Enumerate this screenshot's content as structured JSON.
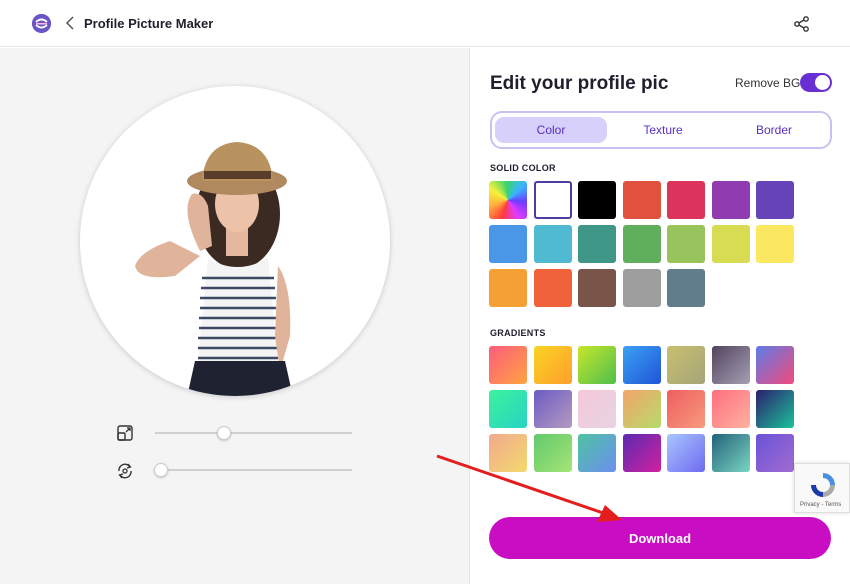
{
  "header": {
    "title": "Profile Picture Maker",
    "logo_icon": "app-logo-icon",
    "back_icon": "chevron-left-icon",
    "share_icon": "share-icon"
  },
  "editor": {
    "title": "Edit your profile pic",
    "remove_bg_label": "Remove BG",
    "remove_bg_enabled": true,
    "tabs": [
      {
        "label": "Color",
        "active": true
      },
      {
        "label": "Texture",
        "active": false
      },
      {
        "label": "Border",
        "active": false
      }
    ],
    "solid_color_label": "SOLID COLOR",
    "gradients_label": "GRADIENTS",
    "solid_colors": [
      "rainbow",
      "#ffffff",
      "#000000",
      "#e0513e",
      "#dc335c",
      "#913bb0",
      "#6444b7",
      "#4a97e8",
      "#4fbad2",
      "#3f9787",
      "#5faf5c",
      "#99c35d",
      "#d7dc53",
      "#fbe760",
      "#f5a035",
      "#f0633a",
      "#795549",
      "#9e9e9e",
      "#617c8b"
    ],
    "selected_solid_color": "#ffffff",
    "gradients": [
      [
        "#fc5c7d",
        "#ffa340"
      ],
      [
        "#f9d423",
        "#ff9e2c"
      ],
      [
        "#c7e52c",
        "#4fbf4c"
      ],
      [
        "#3aa1f2",
        "#2054d8"
      ],
      [
        "#cabf70",
        "#a3a579"
      ],
      [
        "#53445e",
        "#a5a0b4"
      ],
      [
        "#5d7ce8",
        "#f34a7a"
      ],
      [
        "#3df29b",
        "#27d3c4"
      ],
      [
        "#6b5bc4",
        "#b59ac0"
      ],
      [
        "#f4c8d8",
        "#e8d4e4"
      ],
      [
        "#f5a36b",
        "#b5dc6b"
      ],
      [
        "#ef5e5e",
        "#f79a7e"
      ],
      [
        "#ff6e7f",
        "#ffb2a0"
      ],
      [
        "#2c1e6e",
        "#1bc29a"
      ],
      [
        "#f1a990",
        "#f3d96c"
      ],
      [
        "#62c96c",
        "#a5e477"
      ],
      [
        "#4fc3a1",
        "#6c8ff0"
      ],
      [
        "#5b2bb0",
        "#d020a0"
      ],
      [
        "#a9c6ff",
        "#6e6af0"
      ],
      [
        "#23627a",
        "#7ad5c3"
      ],
      [
        "#6a53d6",
        "#a16bd1"
      ]
    ]
  },
  "controls": {
    "zoom_icon": "resize-icon",
    "rotate_icon": "rotate-icon",
    "zoom_value": 0.35,
    "rotate_value": 0.03
  },
  "recaptcha": {
    "text": "Privacy - Terms",
    "icon": "recaptcha-icon"
  },
  "download_label": "Download",
  "colors": {
    "accent": "#6a2fd4",
    "download": "#c80dc2",
    "arrow": "#e41e1e",
    "tab_active_bg": "#d6d0fa"
  }
}
